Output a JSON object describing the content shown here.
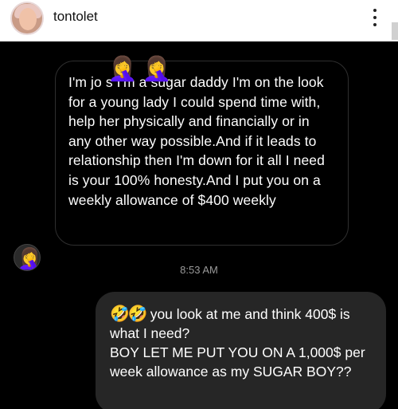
{
  "header": {
    "username": "tontolet",
    "menu_icon": "more-vertical-icon"
  },
  "conversation": {
    "incoming_message": {
      "text": "I'm jo        s       I'm a sugar daddy I'm on the look for a young lady I could spend time with, help her physically and financially or in any other way possible.And if it leads to relationship then I'm down for it all I need is your 100% honesty.And I put you on a weekly allowance of $400 weekly",
      "overlay_emoji": "🤦‍♀️",
      "sender_avatar_emoji": "🤦‍♀️"
    },
    "timestamp": "8:53 AM",
    "outgoing_message": {
      "emoji": "🤣🤣",
      "text": "you look at me and think 400$ is what I need?",
      "text2": "BOY LET ME PUT YOU ON A 1,000$ per week allowance as my SUGAR BOY??"
    }
  }
}
